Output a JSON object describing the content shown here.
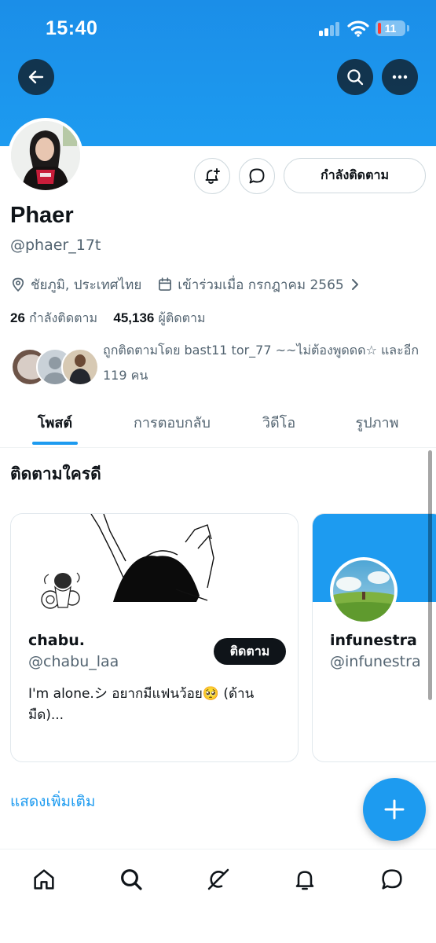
{
  "status_bar": {
    "time": "15:40",
    "battery": "11",
    "battery_level": 0.11,
    "signal_bars": 2
  },
  "header": {
    "back_icon": "back-arrow-icon",
    "search_icon": "search-icon",
    "more_icon": "more-icon"
  },
  "profile": {
    "display_name": "Phaer",
    "handle": "@phaer_17t",
    "location": "ชัยภูมิ, ประเทศไทย",
    "joined": "เข้าร่วมเมื่อ กรกฎาคม 2565",
    "following_count": "26",
    "following_label": "กำลังติดตาม",
    "followers_count": "45,136",
    "followers_label": "ผู้ติดตาม",
    "followed_by": "ถูกติดตามโดย bast11 tor_77 ~~ไม่ต้องพูดดด☆ และอีก 119 คน"
  },
  "actions": {
    "following_button": "กำลังติดตาม",
    "notify_icon": "bell-plus-icon",
    "message_icon": "message-icon"
  },
  "tabs": [
    "โพสต์",
    "การตอบกลับ",
    "วิดีโอ",
    "รูปภาพ"
  ],
  "who_to_follow": {
    "title": "ติดตามใครดี",
    "cards": [
      {
        "name": "chabu.",
        "handle": "@chabu_laa",
        "bio": "I'm alone.シ อยากมีแฟนว้อย🥺 (ด้านมืด)...",
        "follow_label": "ติดตาม"
      },
      {
        "name": "infunestra",
        "handle": "@infunestra"
      }
    ],
    "show_more": "แสดงเพิ่มเติม"
  },
  "fab": {
    "icon": "plus-icon"
  },
  "bottom_nav": [
    "home-icon",
    "search-icon",
    "grok-icon",
    "notifications-icon",
    "messages-icon"
  ],
  "colors": {
    "accent": "#1d9bf0",
    "text_primary": "#0f1419",
    "text_secondary": "#536471",
    "border": "#cfd9de"
  }
}
